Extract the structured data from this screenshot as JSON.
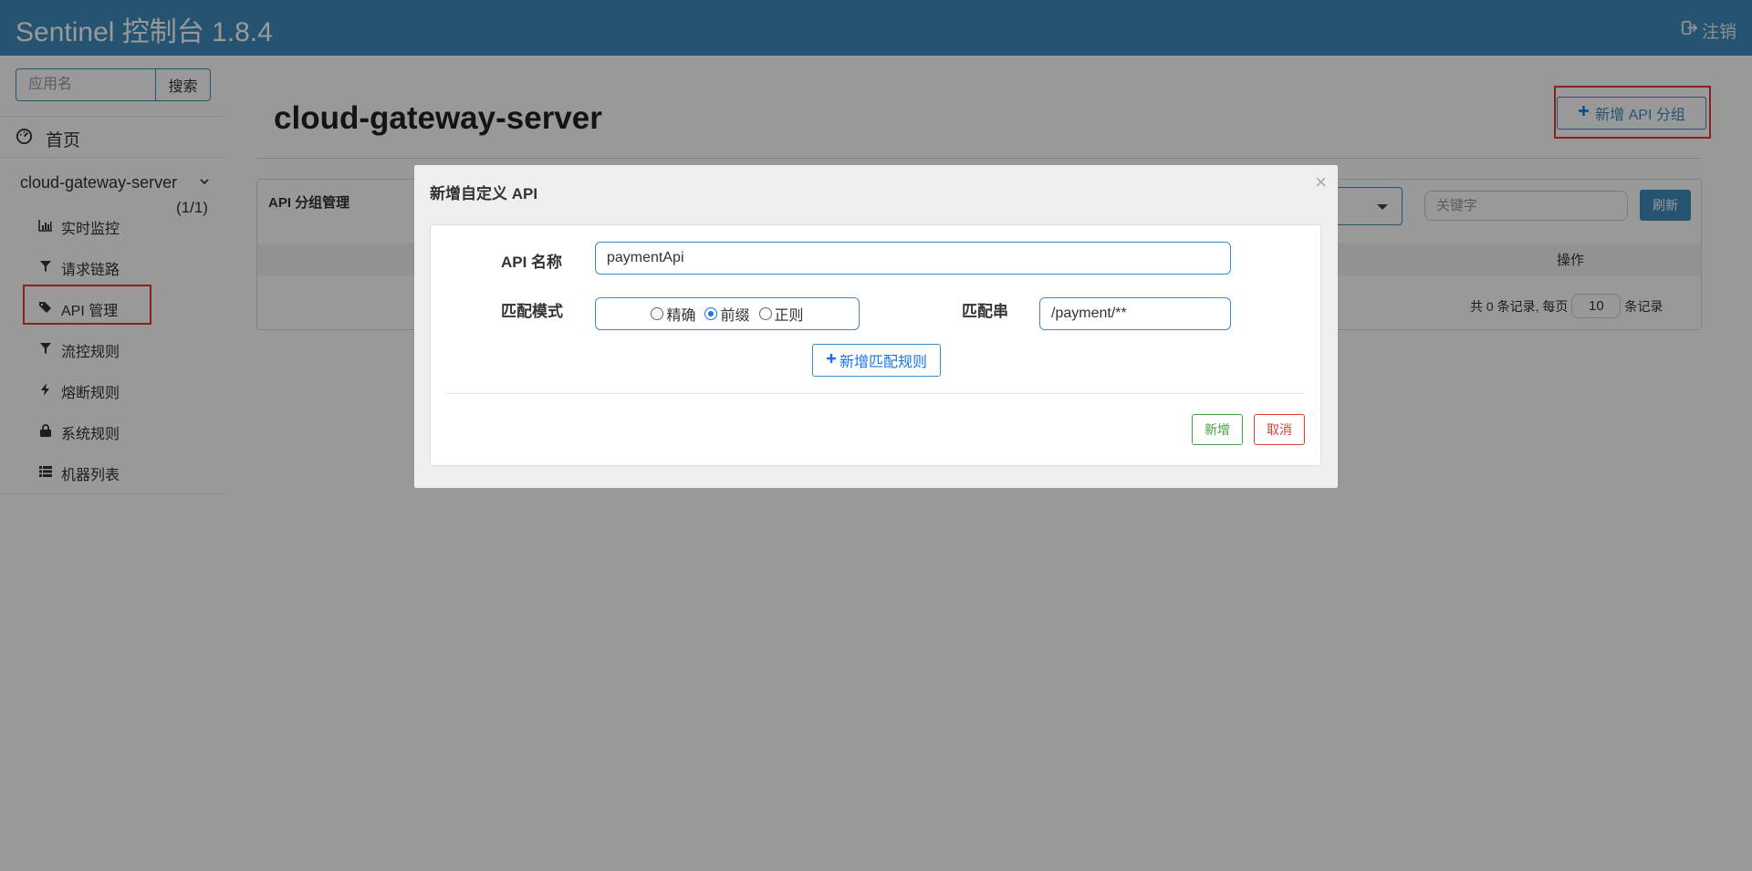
{
  "header": {
    "brand": "Sentinel 控制台 1.8.4",
    "logout_label": "注销"
  },
  "sidebar": {
    "search_placeholder": "应用名",
    "search_button": "搜索",
    "home_label": "首页",
    "app_name": "cloud-gateway-server",
    "app_count": "(1/1)",
    "items": [
      {
        "label": "实时监控",
        "icon": "bar-chart-icon"
      },
      {
        "label": "请求链路",
        "icon": "filter-icon"
      },
      {
        "label": "API 管理",
        "icon": "tags-icon"
      },
      {
        "label": "流控规则",
        "icon": "filter-icon"
      },
      {
        "label": "熔断规则",
        "icon": "bolt-icon"
      },
      {
        "label": "系统规则",
        "icon": "lock-icon"
      },
      {
        "label": "机器列表",
        "icon": "list-icon"
      }
    ],
    "active_item": "API 管理"
  },
  "main": {
    "page_title": "cloud-gateway-server",
    "add_group_button": "新增 API 分组",
    "panel_title": "API 分组管理",
    "keyword_placeholder": "关键字",
    "refresh_button": "刷新",
    "column_ops": "操作",
    "pager": {
      "total_prefix": "共 0 条记录, 每页",
      "page_size": "10",
      "suffix": "条记录"
    }
  },
  "modal": {
    "title": "新增自定义 API",
    "close_symbol": "×",
    "api_name_label": "API 名称",
    "api_name_value": "paymentApi",
    "match_mode_label": "匹配模式",
    "match_modes": [
      "精确",
      "前缀",
      "正则"
    ],
    "match_mode_selected": "前缀",
    "match_string_label": "匹配串",
    "match_string_value": "/payment/**",
    "add_rule_button": "新增匹配规则",
    "confirm_button": "新增",
    "cancel_button": "取消"
  },
  "colors": {
    "header_bg": "#3c8dbc",
    "accent": "#1a73e8",
    "highlight_red": "#e53935",
    "confirm_green": "#43a047"
  }
}
